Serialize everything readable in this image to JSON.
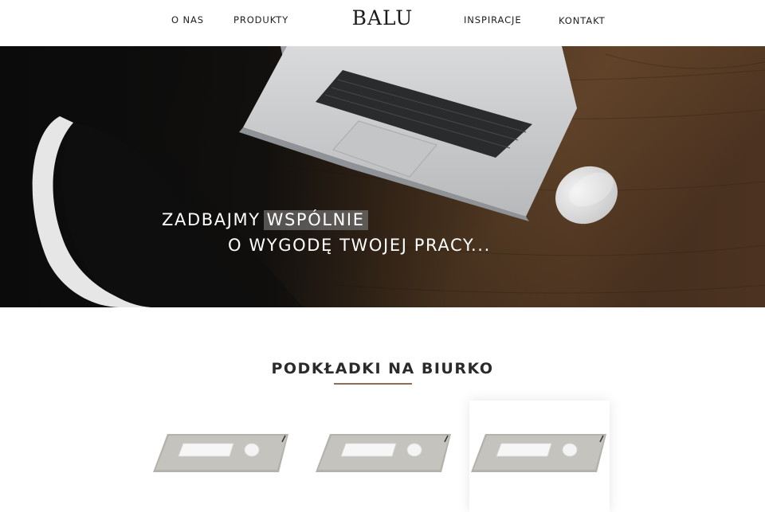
{
  "nav": {
    "left": [
      "O NAS",
      "PRODUKTY"
    ],
    "right": [
      "INSPIRACJE",
      "KONTAKT"
    ],
    "logo": "BALU"
  },
  "hero": {
    "line1_prefix": "ZADBAJMY",
    "line1_highlight": "WSPÓLNIE",
    "line2": "O WYGODĘ TWOJEJ PRACY..."
  },
  "products_section": {
    "title": "PODKŁADKI NA BIURKO",
    "accent_color": "#8a6e55",
    "cards": [
      {
        "image": "desk-pad-image",
        "active": false
      },
      {
        "image": "desk-pad-image",
        "active": false
      },
      {
        "image": "desk-pad-image",
        "active": true
      }
    ]
  }
}
